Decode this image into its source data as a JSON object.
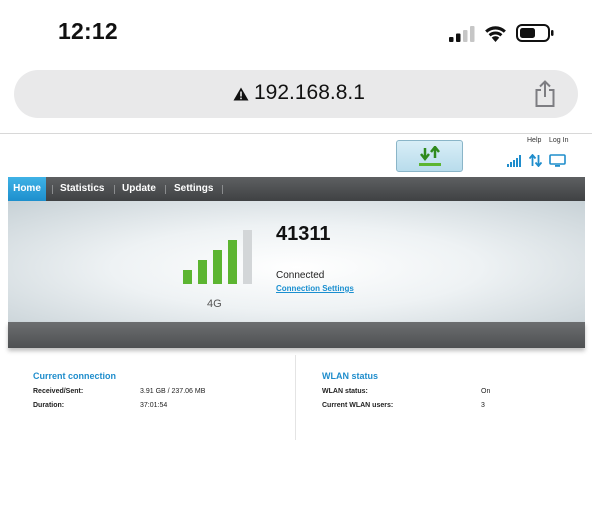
{
  "status_bar": {
    "time": "12:12",
    "icons": [
      "cellular-signal-icon",
      "wifi-icon",
      "battery-icon"
    ]
  },
  "address_bar": {
    "warning_icon": "warning-triangle-icon",
    "url": "192.168.8.1",
    "share_icon": "share-icon"
  },
  "header": {
    "help_label": "Help",
    "login_label": "Log In",
    "icons": [
      "data-transfer-icon",
      "signal-strength-icon",
      "up-down-arrows-icon",
      "monitor-icon"
    ]
  },
  "nav": {
    "tabs": [
      {
        "label": "Home",
        "active": true
      },
      {
        "label": "Statistics",
        "active": false
      },
      {
        "label": "Update",
        "active": false
      },
      {
        "label": "Settings",
        "active": false
      }
    ]
  },
  "hero": {
    "signal_level": 4,
    "signal_max": 5,
    "network_type": "4G",
    "operator": "41311",
    "status": "Connected",
    "settings_link": "Connection Settings"
  },
  "current_connection": {
    "title": "Current connection",
    "rows": [
      {
        "label": "Received/Sent:",
        "value": "3.91 GB /  237.06 MB"
      },
      {
        "label": "Duration:",
        "value": "37:01:54"
      }
    ]
  },
  "wlan_status": {
    "title": "WLAN status",
    "rows": [
      {
        "label": "WLAN status:",
        "value": "On"
      },
      {
        "label": "Current WLAN users:",
        "value": "3"
      }
    ]
  },
  "colors": {
    "accent_blue": "#1f8dcc",
    "nav_active": "#2ea3dd",
    "signal_green": "#5cb531",
    "nav_dark": "#4a4c4e"
  }
}
